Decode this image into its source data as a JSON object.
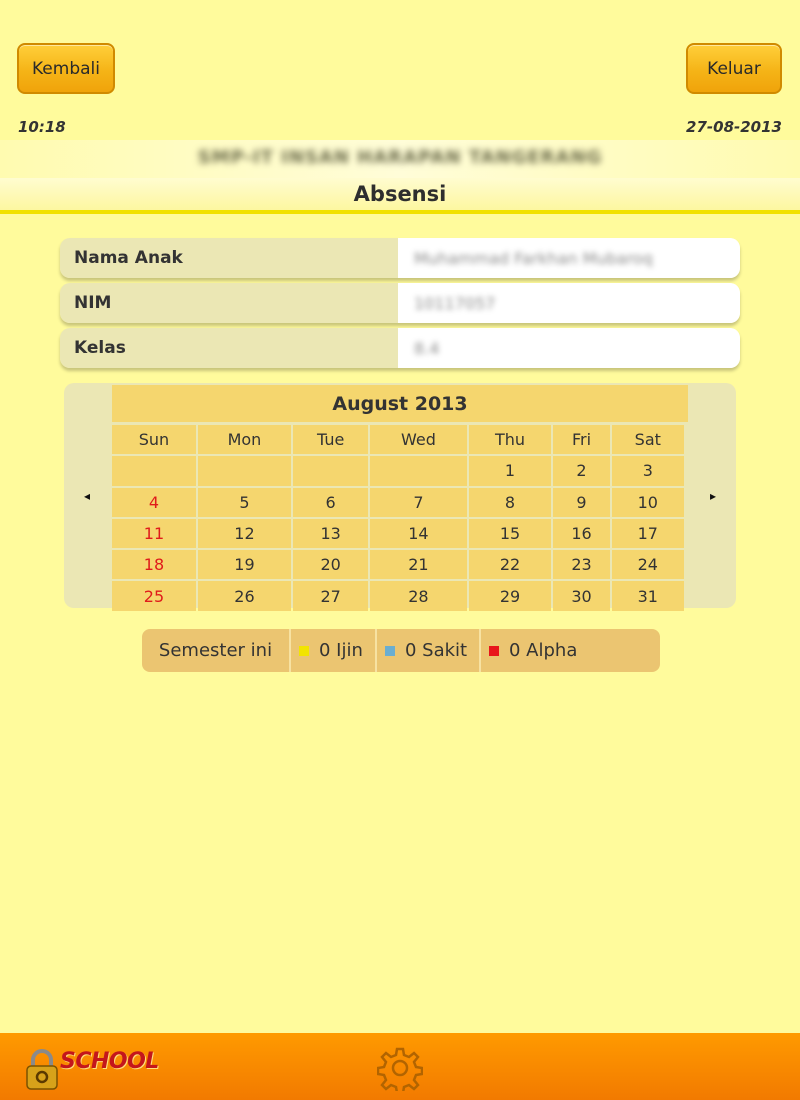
{
  "header": {
    "back_label": "Kembali",
    "exit_label": "Keluar",
    "time": "10:18",
    "date": "27-08-2013",
    "school_name": "SMP-IT INSAN HARAPAN TANGERANG",
    "page_title": "Absensi"
  },
  "student": {
    "rows": [
      {
        "label": "Nama Anak",
        "value": "Muhammad Farkhan Mubaroq"
      },
      {
        "label": "NIM",
        "value": "10117057"
      },
      {
        "label": "Kelas",
        "value": "8.4"
      }
    ]
  },
  "calendar": {
    "month_title": "August 2013",
    "prev_icon": "◂",
    "next_icon": "▸",
    "weekdays": [
      "Sun",
      "Mon",
      "Tue",
      "Wed",
      "Thu",
      "Fri",
      "Sat"
    ],
    "weeks": [
      [
        "",
        "",
        "",
        "",
        "1",
        "2",
        "3"
      ],
      [
        "4",
        "5",
        "6",
        "7",
        "8",
        "9",
        "10"
      ],
      [
        "11",
        "12",
        "13",
        "14",
        "15",
        "16",
        "17"
      ],
      [
        "18",
        "19",
        "20",
        "21",
        "22",
        "23",
        "24"
      ],
      [
        "25",
        "26",
        "27",
        "28",
        "29",
        "30",
        "31"
      ]
    ],
    "sunday_color": "#e01b1b"
  },
  "summary": {
    "label": "Semester ini",
    "ijin": "0 Ijin",
    "sakit": "0 Sakit",
    "alpha": "0 Alpha",
    "colors": {
      "ijin": "#f2e400",
      "sakit": "#6aaed0",
      "alpha": "#e8161b"
    }
  },
  "footer": {
    "logo_text": "SCHOOL",
    "logo_icon": "padlock-icon",
    "settings_icon": "gear-icon"
  }
}
